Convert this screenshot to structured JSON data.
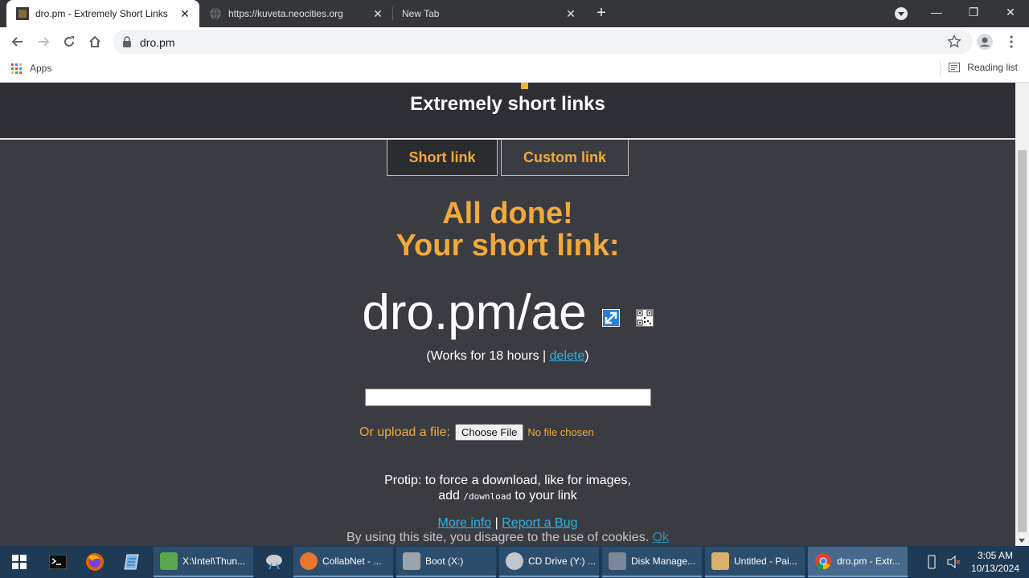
{
  "browser": {
    "tabs": [
      {
        "title": "dro.pm - Extremely Short Links",
        "active": true
      },
      {
        "title": "https://kuveta.neocities.org",
        "active": false
      },
      {
        "title": "New Tab",
        "active": false
      }
    ],
    "address": "dro.pm",
    "bookmarks": {
      "apps_label": "Apps",
      "reading_list_label": "Reading list"
    }
  },
  "page": {
    "tagline": "Extremely short links",
    "tabs": [
      {
        "label": "Short link",
        "selected": true
      },
      {
        "label": "Custom link",
        "selected": false
      }
    ],
    "done_line1": "All done!",
    "done_line2": "Your short link:",
    "short_link": "dro.pm/ae",
    "works_prefix": "(Works for 18 hours | ",
    "delete_label": "delete",
    "works_suffix": ")",
    "upload_label": "Or upload a file:",
    "choose_file_label": "Choose File",
    "no_file_label": "No file chosen",
    "protip_line1": "Protip: to force a download, like for images,",
    "protip_add": "add",
    "protip_code": "/download",
    "protip_tail": "to your link",
    "more_info_label": "More info",
    "links_sep": " | ",
    "report_bug_label": "Report a Bug",
    "cookies_text": "By using this site, you disagree to the use of cookies. ",
    "ok_label": "Ok"
  },
  "taskbar": {
    "items": [
      {
        "label": "X:\\Intel\\Thun...",
        "color": "#5aa64c"
      },
      {
        "label": "CollabNet - ...",
        "color": "#e8762d"
      },
      {
        "label": "Boot (X:)",
        "color": "#9aa4ad"
      },
      {
        "label": "CD Drive (Y:) ...",
        "color": "#c0c6cc"
      },
      {
        "label": "Disk Manage...",
        "color": "#7b8794"
      },
      {
        "label": "Untitled - Pai...",
        "color": "#d9b06a"
      },
      {
        "label": "dro.pm - Extr...",
        "color": "#dd4b3e"
      }
    ],
    "time": "3:05 AM",
    "date": "10/13/2024"
  },
  "colors": {
    "accent": "#f2a93b",
    "link": "#2bb5e8",
    "page_bg": "#3b3c42",
    "header_bg": "#2e2f34"
  }
}
